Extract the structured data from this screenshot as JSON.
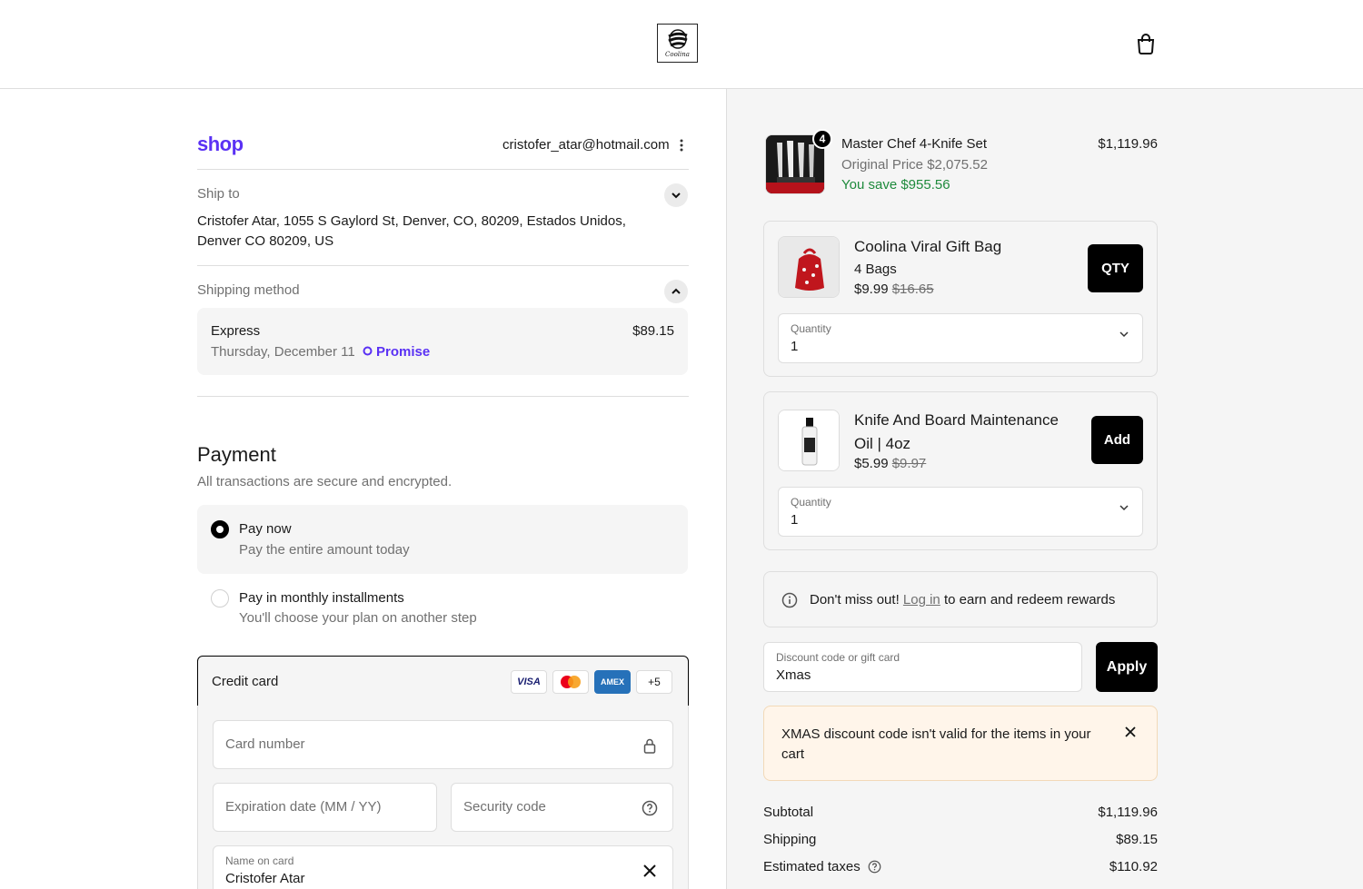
{
  "header": {
    "logo_text": "Coolina",
    "cart_icon": "shopping-bag-icon"
  },
  "account": {
    "brand": "shop",
    "email": "cristofer_atar@hotmail.com"
  },
  "ship_to": {
    "label": "Ship to",
    "address_line1": "Cristofer Atar, 1055 S Gaylord St, Denver, CO, 80209, Estados Unidos,",
    "address_line2": "Denver CO 80209, US"
  },
  "shipping_method": {
    "label": "Shipping method",
    "name": "Express",
    "date": "Thursday, December 11",
    "promise": "Promise",
    "price": "$89.15"
  },
  "payment": {
    "title": "Payment",
    "subtitle": "All transactions are secure and encrypted.",
    "options": [
      {
        "label": "Pay now",
        "desc": "Pay the entire amount today",
        "selected": true
      },
      {
        "label": "Pay in monthly installments",
        "desc": "You'll choose your plan on another step",
        "selected": false
      }
    ],
    "credit_card": {
      "label": "Credit card",
      "brands": [
        "VISA",
        "mastercard",
        "AMEX"
      ],
      "more": "+5",
      "card_number_ph": "Card number",
      "expiry_ph": "Expiration date (MM / YY)",
      "cvv_ph": "Security code",
      "name_label": "Name on card",
      "name_value": "Cristofer Atar"
    }
  },
  "cart": {
    "item": {
      "name": "Master Chef 4-Knife Set",
      "original": "Original Price $2,075.52",
      "save": "You save $955.56",
      "price": "$1,119.96",
      "qty": "4"
    },
    "upsells": [
      {
        "name": "Coolina Viral Gift Bag",
        "variant": "4 Bags",
        "price": "$9.99",
        "compare": "$16.65",
        "button": "QTY",
        "qty_label": "Quantity",
        "qty_value": "1"
      },
      {
        "name": "Knife And Board Maintenance Oil | 4oz",
        "variant": "",
        "price": "$5.99",
        "compare": "$9.97",
        "button": "Add",
        "qty_label": "Quantity",
        "qty_value": "1"
      }
    ],
    "rewards": {
      "prefix": "Don't miss out!",
      "link": "Log in",
      "suffix": "to earn and redeem rewards"
    },
    "discount": {
      "label": "Discount code or gift card",
      "value": "Xmas",
      "button": "Apply",
      "error": "XMAS discount code isn't valid for the items in your cart"
    },
    "summary": [
      {
        "label": "Subtotal",
        "value": "$1,119.96"
      },
      {
        "label": "Shipping",
        "value": "$89.15"
      },
      {
        "label": "Estimated taxes",
        "value": "$110.92"
      }
    ]
  },
  "colors": {
    "shop_purple": "#5a31f4",
    "save_green": "#1e8a3c",
    "warn_bg": "#fff5ea"
  }
}
